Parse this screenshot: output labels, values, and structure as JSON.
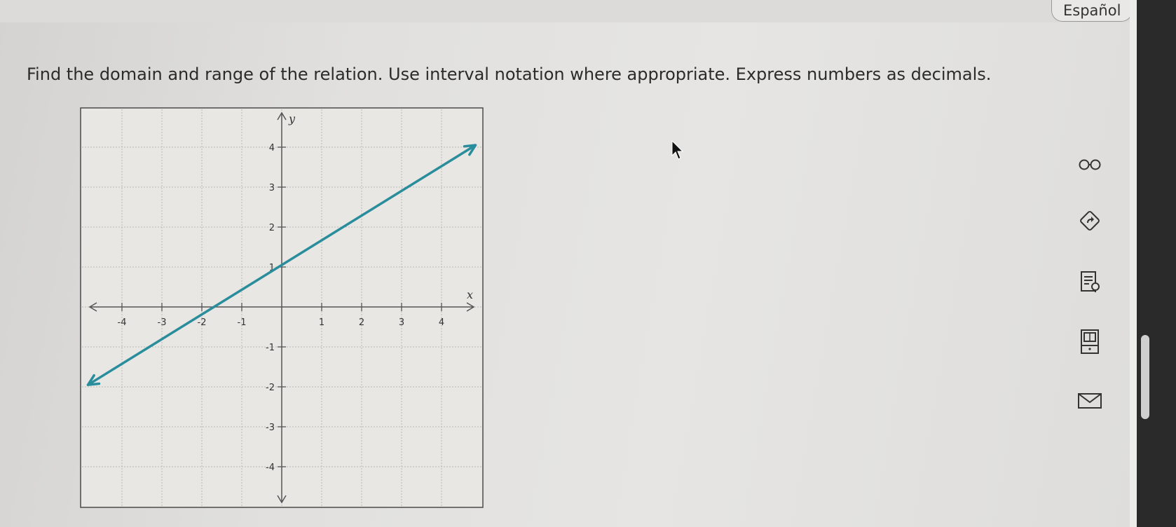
{
  "header": {
    "language_button": "Español"
  },
  "question": {
    "text": "Find the domain and range of the relation. Use interval notation where appropriate. Express numbers as decimals."
  },
  "graph": {
    "x_axis_label": "x",
    "y_axis_label": "y",
    "x_tick_labels": [
      "-4",
      "-3",
      "-2",
      "-1",
      "1",
      "2",
      "3",
      "4"
    ],
    "y_tick_labels": [
      "4",
      "3",
      "2",
      "1",
      "-1",
      "-2",
      "-3",
      "-4"
    ],
    "xlim": [
      -4.6,
      4.9
    ],
    "ylim": [
      -4.9,
      5.1
    ],
    "line": {
      "from": [
        -4.85,
        -1.95
      ],
      "to": [
        4.85,
        4.05
      ],
      "arrows": "both",
      "color": "#2a8d9c"
    }
  },
  "tools": [
    {
      "icon": "glasses-icon"
    },
    {
      "icon": "redo-diamond-icon"
    },
    {
      "icon": "notes-lightbulb-icon"
    },
    {
      "icon": "calculator-book-icon"
    },
    {
      "icon": "mail-icon"
    }
  ]
}
